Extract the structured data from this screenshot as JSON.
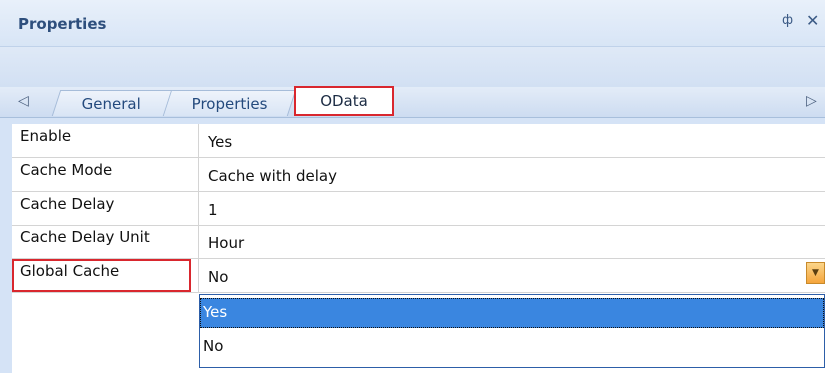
{
  "panel": {
    "title": "Properties",
    "pin_icon": "pin-icon",
    "close_icon": "close-icon",
    "pin_glyph": "ф",
    "close_glyph": "✕"
  },
  "tabs": {
    "scroll_left": "◁",
    "scroll_right": "▷",
    "items": [
      {
        "label": "General"
      },
      {
        "label": "Properties"
      },
      {
        "label": "OData",
        "active": true
      }
    ]
  },
  "rows": [
    {
      "name": "Enable",
      "value": "Yes"
    },
    {
      "name": "Cache Mode",
      "value": "Cache with delay"
    },
    {
      "name": "Cache Delay",
      "value": "1"
    },
    {
      "name": "Cache Delay Unit",
      "value": "Hour"
    },
    {
      "name": "Global Cache",
      "value": "No"
    }
  ],
  "dropdown": {
    "button_glyph": "▼",
    "options": [
      {
        "label": "Yes",
        "highlighted": true
      },
      {
        "label": "No"
      }
    ]
  },
  "colors": {
    "highlight_box": "#d9272e",
    "selected_option": "#3a86e0",
    "dropdown_button": "#f5a53c"
  }
}
